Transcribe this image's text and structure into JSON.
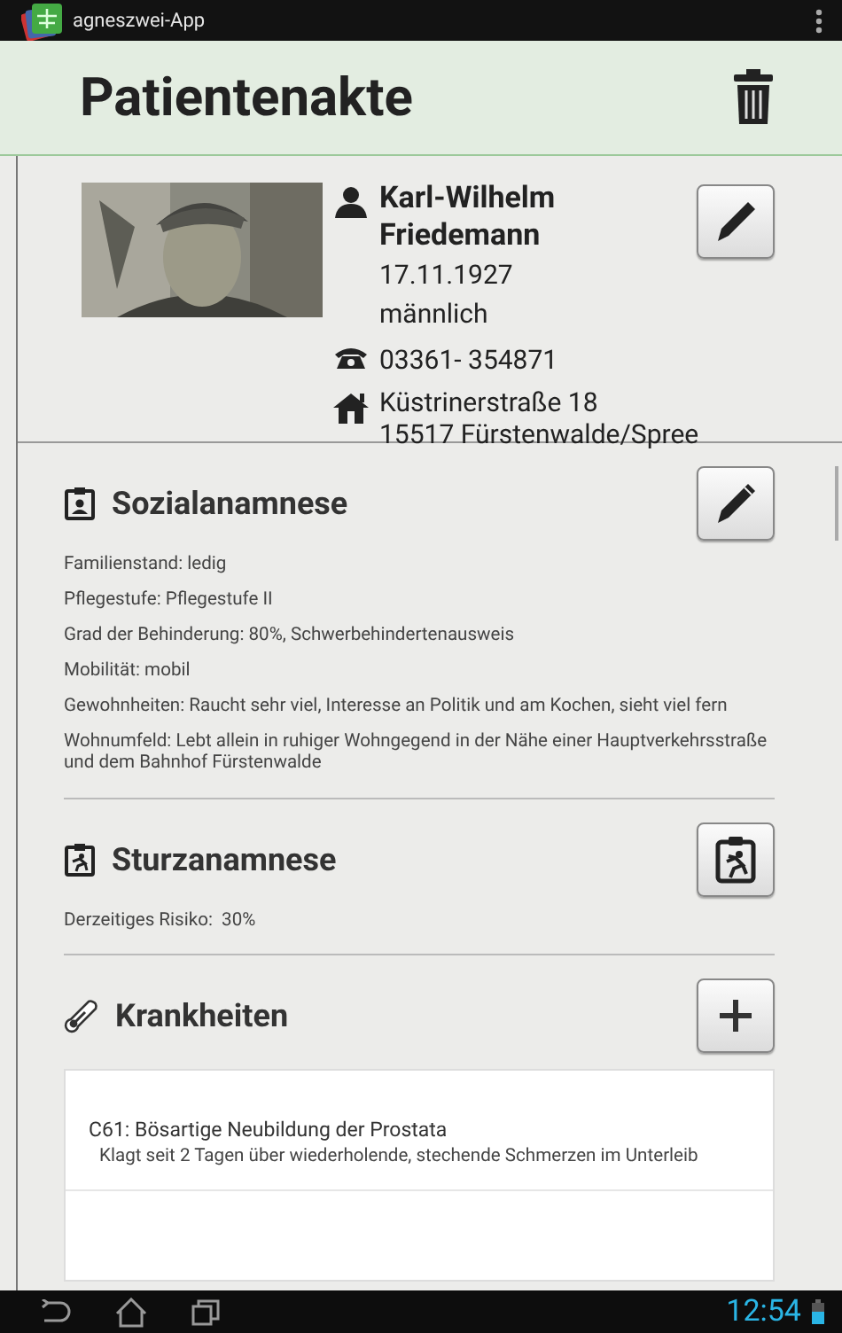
{
  "app_bar": {
    "title": "agneszwei-App"
  },
  "header": {
    "title": "Patientenakte"
  },
  "patient": {
    "name": "Karl-Wilhelm Friedemann",
    "birth_date": "17.11.1927",
    "gender": "männlich",
    "phone": "03361- 354871",
    "address_lines": [
      "Küstrinerstraße 18",
      "15517 Fürstenwalde/Spree"
    ]
  },
  "sections": [
    {
      "kind": "social",
      "title": "Sozialanamnese",
      "lines": [
        "Familienstand: ledig",
        "Pflegestufe: Pflegestufe II",
        "Grad der Behinderung: 80%, Schwerbehindertenausweis",
        "Mobilität: mobil",
        "Gewohnheiten: Raucht sehr viel, Interesse an Politik und am Kochen, sieht viel fern",
        "Wohnumfeld: Lebt allein in ruhiger Wohngegend in der Nähe einer Hauptverkehrsstraße und dem Bahnhof Fürstenwalde"
      ]
    },
    {
      "kind": "fall",
      "title": "Sturzanamnese",
      "lines": [
        "Derzeitiges Risiko:  30%"
      ]
    },
    {
      "kind": "diseases",
      "title": "Krankheiten",
      "items": [
        {
          "title": "C61: Bösartige Neubildung der Prostata",
          "note": "Klagt seit 2 Tagen über wiederholende, stechende Schmerzen im Unterleib"
        }
      ]
    }
  ],
  "nav_bar": {
    "time": "12:54"
  }
}
